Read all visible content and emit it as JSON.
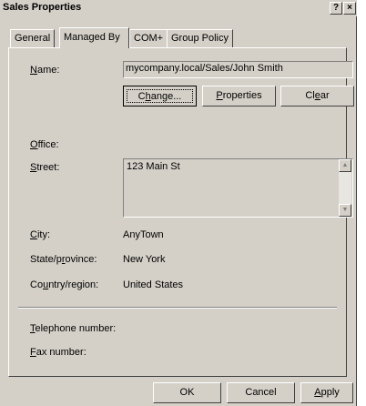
{
  "window": {
    "title": "Sales Properties",
    "help_label": "?",
    "close_label": "×"
  },
  "tabs": [
    {
      "label": "General"
    },
    {
      "label": "Managed By"
    },
    {
      "label": "COM+"
    },
    {
      "label": "Group Policy"
    }
  ],
  "form": {
    "name": {
      "label_u": "N",
      "label_rest": "ame:",
      "value": "mycompany.local/Sales/John Smith"
    },
    "change_button": {
      "pre": "C",
      "u": "h",
      "post": "ange..."
    },
    "properties_button": {
      "u": "P",
      "post": "roperties"
    },
    "clear_button": {
      "pre": "Cl",
      "u": "e",
      "post": "ar"
    },
    "office": {
      "label_u": "O",
      "label_rest": "ffice:",
      "value": ""
    },
    "street": {
      "label_u": "S",
      "label_rest": "treet:",
      "value": "123 Main St"
    },
    "city": {
      "label_u": "C",
      "label_rest": "ity:",
      "value": "AnyTown"
    },
    "state": {
      "label_pre": "State/p",
      "label_u": "r",
      "label_rest": "ovince:",
      "value": "New York"
    },
    "country": {
      "label_pre": "Co",
      "label_u": "u",
      "label_rest": "ntry/region:",
      "value": "United States"
    },
    "telephone": {
      "label_u": "T",
      "label_rest": "elephone number:",
      "value": ""
    },
    "fax": {
      "label_u": "F",
      "label_rest": "ax number:",
      "value": ""
    }
  },
  "footer": {
    "ok_label": "OK",
    "cancel_label": "Cancel",
    "apply": {
      "u": "A",
      "post": "pply"
    }
  },
  "icons": {
    "scroll_up": "up-arrow-icon",
    "scroll_down": "down-arrow-icon"
  }
}
